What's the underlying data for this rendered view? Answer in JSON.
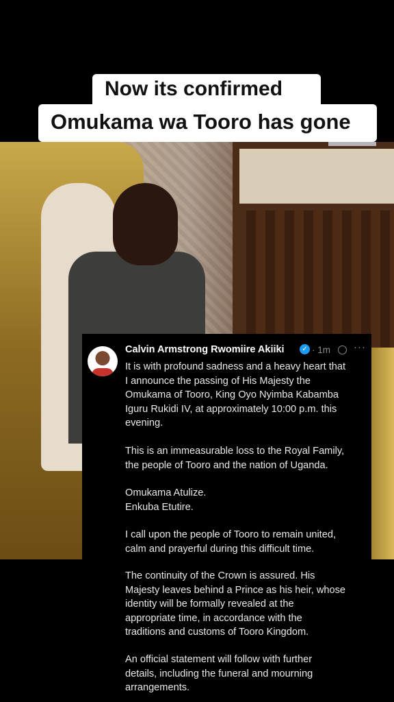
{
  "overlay": {
    "caption_line1": "Now its confirmed",
    "caption_line2": "Omukama wa Tooro has gone"
  },
  "tweet": {
    "author": "Calvin Armstrong Rwomiire Akiiki",
    "time": "· 1m",
    "more": "···",
    "paragraphs": [
      [
        "It is with profound sadness and a heavy heart that",
        "I announce the passing of His Majesty the",
        "Omukama of Tooro, King Oyo Nyimba Kabamba",
        "Iguru Rukidi IV, at approximately 10:00 p.m. this",
        "evening."
      ],
      [
        "This is an immeasurable loss to the Royal Family,",
        "the people of Tooro and the nation of Uganda."
      ],
      [
        "Omukama Atulize.",
        "Enkuba Etutire."
      ],
      [
        "I call upon the people of Tooro to remain united,",
        "calm and prayerful during this difficult time."
      ],
      [
        "The continuity of the Crown is assured. His",
        "Majesty leaves behind a Prince as his heir, whose",
        "identity will be formally revealed at the",
        "appropriate time, in accordance with the",
        "traditions and customs of Tooro Kingdom."
      ],
      [
        "An official statement will follow with further",
        "details, including the funeral and mourning",
        "arrangements."
      ]
    ]
  },
  "colors": {
    "verified_badge": "#1d9bf0",
    "caption_bg": "#ffffff",
    "tweet_bg": "#000000"
  }
}
